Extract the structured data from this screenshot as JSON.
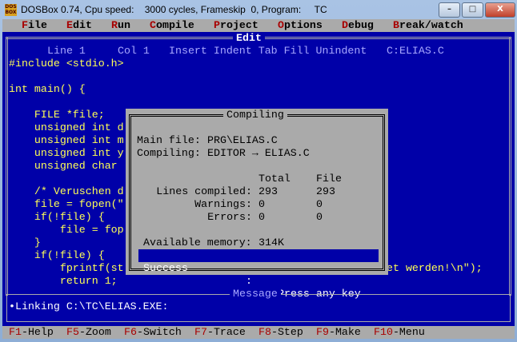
{
  "window": {
    "title": "DOSBox 0.74, Cpu speed:    3000 cycles, Frameskip  0, Program:     TC",
    "icon_text": "DOS BOX",
    "minimize": "–",
    "maximize": "□",
    "close": "X"
  },
  "menu": [
    {
      "hot": "F",
      "rest": "ile"
    },
    {
      "hot": "E",
      "rest": "dit"
    },
    {
      "hot": "R",
      "rest": "un"
    },
    {
      "hot": "C",
      "rest": "ompile"
    },
    {
      "hot": "P",
      "rest": "roject"
    },
    {
      "hot": "O",
      "rest": "ptions"
    },
    {
      "hot": "D",
      "rest": "ebug"
    },
    {
      "hot": "B",
      "rest": "reak/watch"
    }
  ],
  "editor": {
    "title": "Edit",
    "status": {
      "line": "Line 1",
      "col": "Col 1",
      "modes": "Insert Indent Tab Fill Unindent",
      "file": "C:ELIAS.C"
    },
    "lines": [
      "#include <stdio.h>",
      "",
      "int main() {",
      "",
      "    FILE *file;",
      "    unsigned int d",
      "    unsigned int m",
      "    unsigned int y",
      "    unsigned char",
      "",
      "    /* Veruschen d",
      "    file = fopen(\"",
      "    if(!file) {",
      "        file = fop",
      "    }",
      "    if(!file) {",
      "        fprintf(st",
      "        return 1;"
    ],
    "line19_tail": "et werden!\\n\");"
  },
  "dialog": {
    "title": "Compiling",
    "main_file_label": "Main file:",
    "main_file": "PRG\\ELIAS.C",
    "compiling_label": "Compiling:",
    "compiling": "EDITOR → ELIAS.C",
    "col_total": "Total",
    "col_file": "File",
    "stats": [
      {
        "label": "Lines compiled:",
        "total": "293",
        "file": "293"
      },
      {
        "label": "Warnings:",
        "total": "0",
        "file": "0"
      },
      {
        "label": "Errors:",
        "total": "0",
        "file": "0"
      }
    ],
    "memory_label": "Available memory:",
    "memory": "314K",
    "status": "Success",
    "sep": ":",
    "prompt": "Press any key"
  },
  "message": {
    "title": "Message",
    "text": "•Linking C:\\TC\\ELIAS.EXE:"
  },
  "fkeys": [
    {
      "key": "F1",
      "label": "-Help"
    },
    {
      "key": "F5",
      "label": "-Zoom"
    },
    {
      "key": "F6",
      "label": "-Switch"
    },
    {
      "key": "F7",
      "label": "-Trace"
    },
    {
      "key": "F8",
      "label": "-Step"
    },
    {
      "key": "F9",
      "label": "-Make"
    },
    {
      "key": "F10",
      "label": "-Menu"
    }
  ]
}
